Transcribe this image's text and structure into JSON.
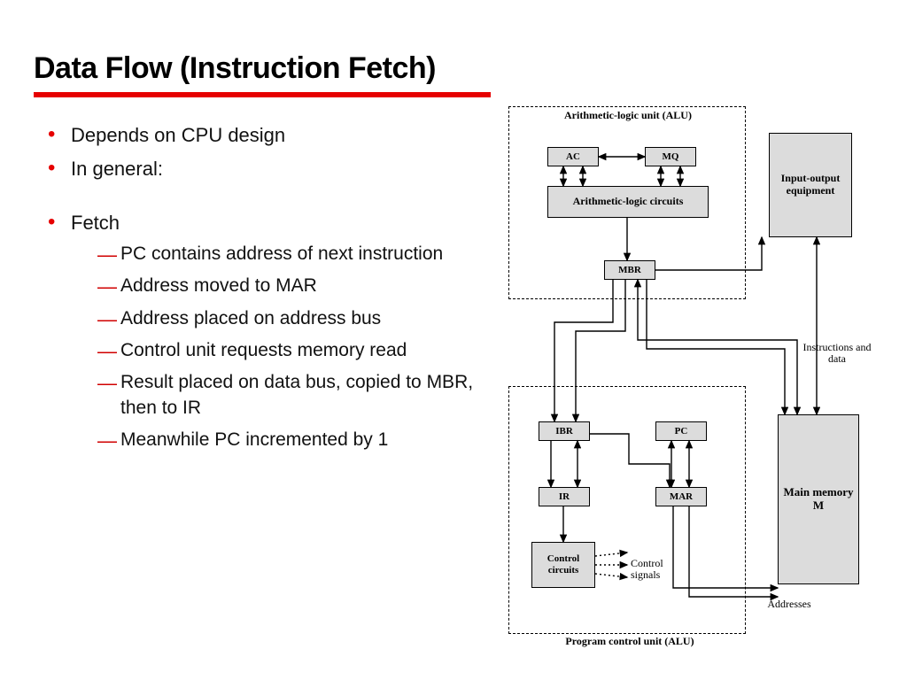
{
  "title": "Data Flow (Instruction Fetch)",
  "bullets": {
    "b1": "Depends on CPU design",
    "b2": "In general:",
    "b3": "Fetch"
  },
  "dashes": {
    "d1": "PC contains address of next instruction",
    "d2": "Address moved to MAR",
    "d3": "Address placed on address bus",
    "d4": "Control unit requests memory read",
    "d5": "Result placed on data bus, copied to MBR, then to IR",
    "d6": "Meanwhile PC incremented by 1"
  },
  "diagram": {
    "alu_group": "Arithmetic-logic unit (ALU)",
    "ac": "AC",
    "mq": "MQ",
    "alc": "Arithmetic-logic circuits",
    "mbr": "MBR",
    "io": "Input-output equipment",
    "instr_data": "Instructions and data",
    "ibr": "IBR",
    "pc": "PC",
    "ir": "IR",
    "mar": "MAR",
    "cc": "Control circuits",
    "cs": "Control signals",
    "main_mem": "Main memory M",
    "addresses": "Addresses",
    "pcu": "Program control unit (ALU)"
  }
}
